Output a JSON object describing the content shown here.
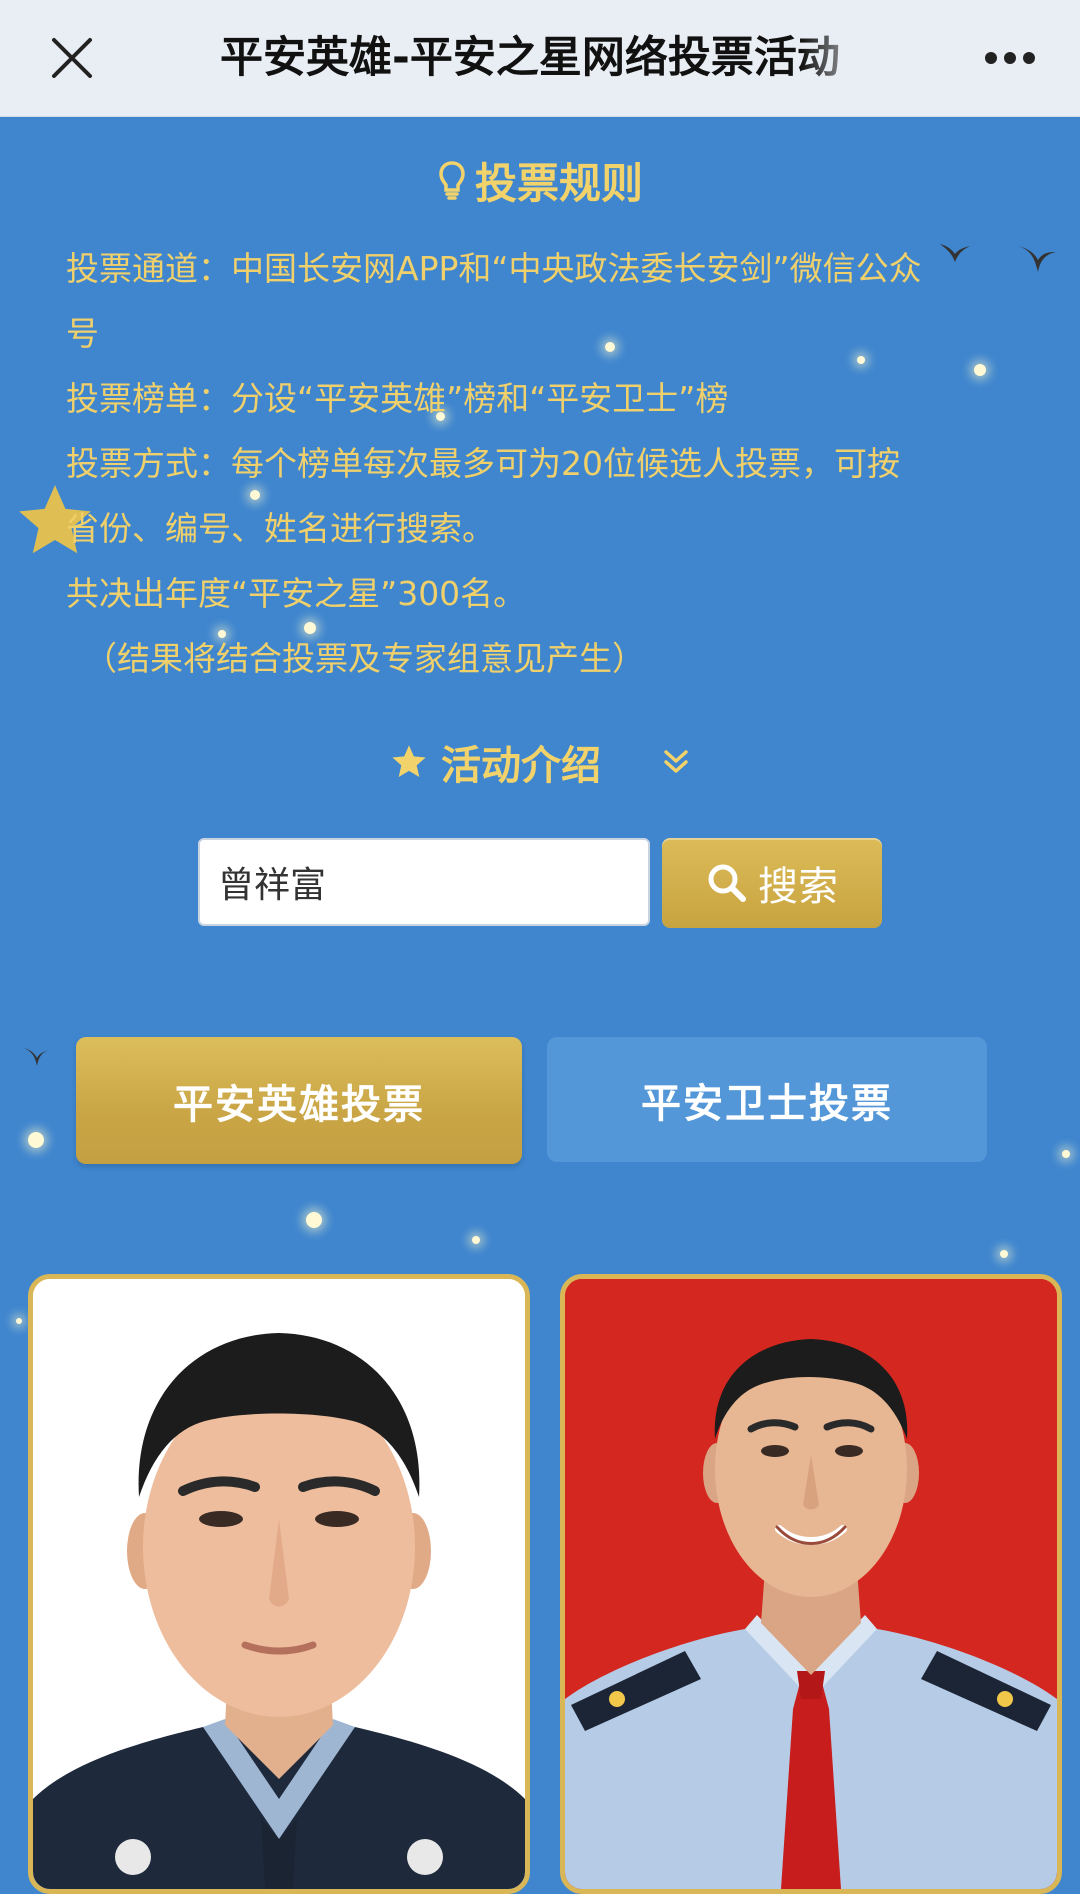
{
  "header": {
    "title": "平安英雄-平安之星网络投票活动",
    "close_icon": "close-icon",
    "more_icon": "more-dots-icon"
  },
  "rules": {
    "heading": "投票规则",
    "heading_icon": "lightbulb-icon",
    "lines": [
      "投票通道：中国长安网APP和“中央政法委长安剑”微信公众",
      "号",
      "投票榜单：分设“平安英雄”榜和“平安卫士”榜",
      "投票方式：每个榜单每次最多可为20位候选人投票，可按",
      "省份、编号、姓名进行搜索。",
      "共决出年度“平安之星”300名。",
      "（结果将结合投票及专家组意见产生）"
    ]
  },
  "intro": {
    "label": "活动介绍",
    "star_icon": "star-icon",
    "expand_icon": "double-chevron-down-icon"
  },
  "search": {
    "value": "曾祥富",
    "button_label": "搜索",
    "button_icon": "search-icon"
  },
  "tabs": [
    {
      "label": "平安英雄投票",
      "active": true
    },
    {
      "label": "平安卫士投票",
      "active": false
    }
  ],
  "candidates": [
    {
      "photo": "candidate-photo-police-uniform",
      "background": "#ffffff"
    },
    {
      "photo": "candidate-photo-red-background",
      "background": "#d4271f"
    }
  ],
  "colors": {
    "page_background": "#3f86cf",
    "gold_text": "#f0d06a",
    "gold_button": "#c9a545",
    "inactive_tab": "#5397d8",
    "top_bar": "#e9eef4"
  }
}
